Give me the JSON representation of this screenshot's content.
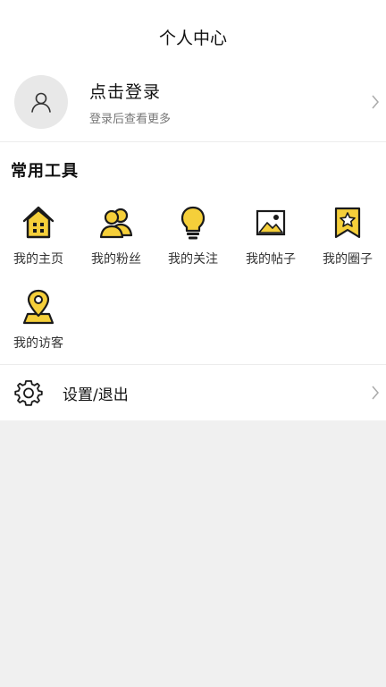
{
  "header": {
    "title": "个人中心"
  },
  "login": {
    "title": "点击登录",
    "subtitle": "登录后查看更多"
  },
  "tools": {
    "section_title": "常用工具",
    "items": [
      {
        "label": "我的主页",
        "icon": "home-icon"
      },
      {
        "label": "我的粉丝",
        "icon": "fans-icon"
      },
      {
        "label": "我的关注",
        "icon": "lightbulb-icon"
      },
      {
        "label": "我的帖子",
        "icon": "image-icon"
      },
      {
        "label": "我的圈子",
        "icon": "bookmark-star-icon"
      },
      {
        "label": "我的访客",
        "icon": "location-pin-icon"
      }
    ]
  },
  "settings": {
    "label": "设置/退出",
    "icon": "gear-icon"
  },
  "colors": {
    "accent": "#f5cf3a",
    "outline": "#1a1a1a",
    "background": "#f0f0f0"
  }
}
